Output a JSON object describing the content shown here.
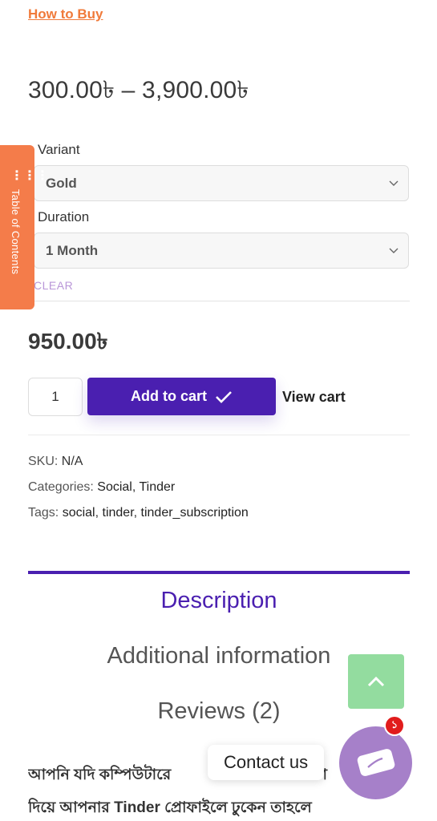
{
  "link": {
    "how_to_buy": "How to Buy"
  },
  "price_range": "300.00৳  – 3,900.00৳",
  "variations": {
    "variant_label": "Variant",
    "variant_value": "Gold",
    "duration_label": "Duration",
    "duration_value": "1 Month",
    "clear": "CLEAR"
  },
  "price": "950.00৳",
  "cart": {
    "quantity": "1",
    "add_to_cart": "Add to cart",
    "view_cart": "View cart"
  },
  "meta": {
    "sku_label": "SKU:",
    "sku_value": "N/A",
    "categories_label": "Categories:",
    "categories": [
      "Social",
      "Tinder"
    ],
    "tags_label": "Tags:",
    "tags": [
      "social",
      "tinder",
      "tinder_subscription"
    ]
  },
  "tabs": [
    "Description",
    "Additional information",
    "Reviews (2)"
  ],
  "description_text": {
    "line1": "আপনি যদি কম্পিউটারে",
    "line1_end": "তা",
    "line2": "দিয়ে আপনার Tinder প্রোফাইলে ঢুকেন তাহলে"
  },
  "toc": {
    "label": "Table of Contents",
    "icon": "list-icon"
  },
  "contact": {
    "label": "Contact us",
    "badge": "১"
  },
  "colors": {
    "accent": "#4a1fb0",
    "link": "#f07a3a",
    "toc": "#f47c4a",
    "scroll_top": "#93dc9f",
    "chat": "#a680c9"
  }
}
